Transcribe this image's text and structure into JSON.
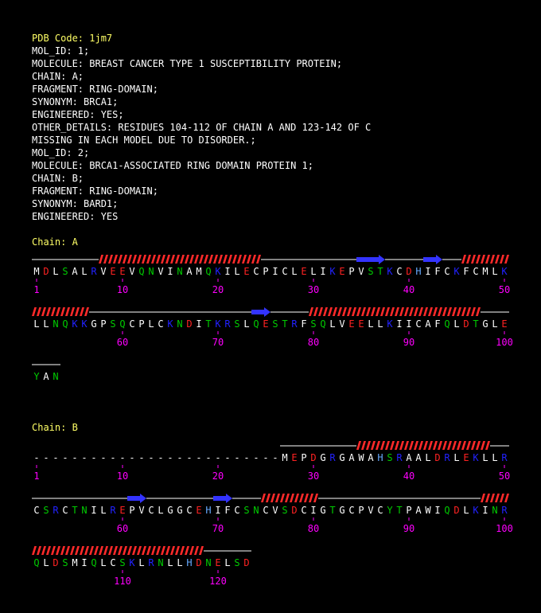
{
  "header": {
    "pdb_code": "PDB Code: 1jm7",
    "lines": [
      "MOL_ID: 1;",
      "MOLECULE: BREAST CANCER TYPE 1 SUSCEPTIBILITY PROTEIN;",
      "CHAIN: A;",
      "FRAGMENT: RING-DOMAIN;",
      "SYNONYM: BRCA1;",
      "ENGINEERED: YES;",
      "OTHER_DETAILS: RESIDUES 104-112 OF CHAIN A AND 123-142 OF C",
      "MISSING IN EACH MODEL DUE TO DISORDER.;",
      "MOL_ID: 2;",
      "MOLECULE: BRCA1-ASSOCIATED RING DOMAIN PROTEIN 1;",
      "CHAIN: B;",
      "FRAGMENT: RING-DOMAIN;",
      "SYNONYM: BARD1;",
      "ENGINEERED: YES"
    ]
  },
  "colors": {
    "hydrophobic": "#ffffff",
    "polar": "#00cc00",
    "acidic": "#ff2222",
    "basic": "#2222ff",
    "histidine": "#66aaff",
    "numbers": "#ff00ff",
    "helix": "#ff2a2a",
    "strand": "#3333ff",
    "coil": "#ffffff",
    "title": "#ffff66"
  },
  "chains": [
    {
      "title": "Chain: A",
      "sequence": "MDLSALRVEEVQNVINAMQKILECPICLELIKEPVSTKCDHIFCKFCMLKLLNQKKGPSQCPLCKNDITKRSLQESTRFSQLVEELLKIICAFQLDTGLEYAN",
      "numbering": [
        "1",
        "10",
        "20",
        "30",
        "40",
        "50",
        "60",
        "70",
        "80",
        "90",
        "100"
      ],
      "ss": [
        {
          "type": "helix",
          "from": 7,
          "to": 23
        },
        {
          "type": "strand",
          "from": 34,
          "to": 36
        },
        {
          "type": "strand",
          "from": 41,
          "to": 42
        },
        {
          "type": "helix",
          "from": 45,
          "to": 55
        },
        {
          "type": "strand",
          "from": 73,
          "to": 74
        },
        {
          "type": "helix",
          "from": 79,
          "to": 96
        }
      ]
    },
    {
      "title": "Chain: B",
      "sequence": "--------------------------MEPDGRGAWAHSRAALDRLEKLLRCSRCTNILREPVCLGGCEHIFCSNCVSDCIGTGCPVCYTPAWIQDLKINRQLDSMIQLCSKLRNLLHDNELSD",
      "numbering": [
        "1",
        "10",
        "20",
        "30",
        "40",
        "50",
        "60",
        "70",
        "80",
        "90",
        "100",
        "110",
        "120"
      ],
      "ss": [
        {
          "type": "helix",
          "from": 34,
          "to": 47
        },
        {
          "type": "strand",
          "from": 60,
          "to": 61
        },
        {
          "type": "strand",
          "from": 69,
          "to": 70
        },
        {
          "type": "helix",
          "from": 74,
          "to": 79
        },
        {
          "type": "helix",
          "from": 97,
          "to": 100
        },
        {
          "type": "helix",
          "from": 101,
          "to": 117
        }
      ]
    }
  ]
}
